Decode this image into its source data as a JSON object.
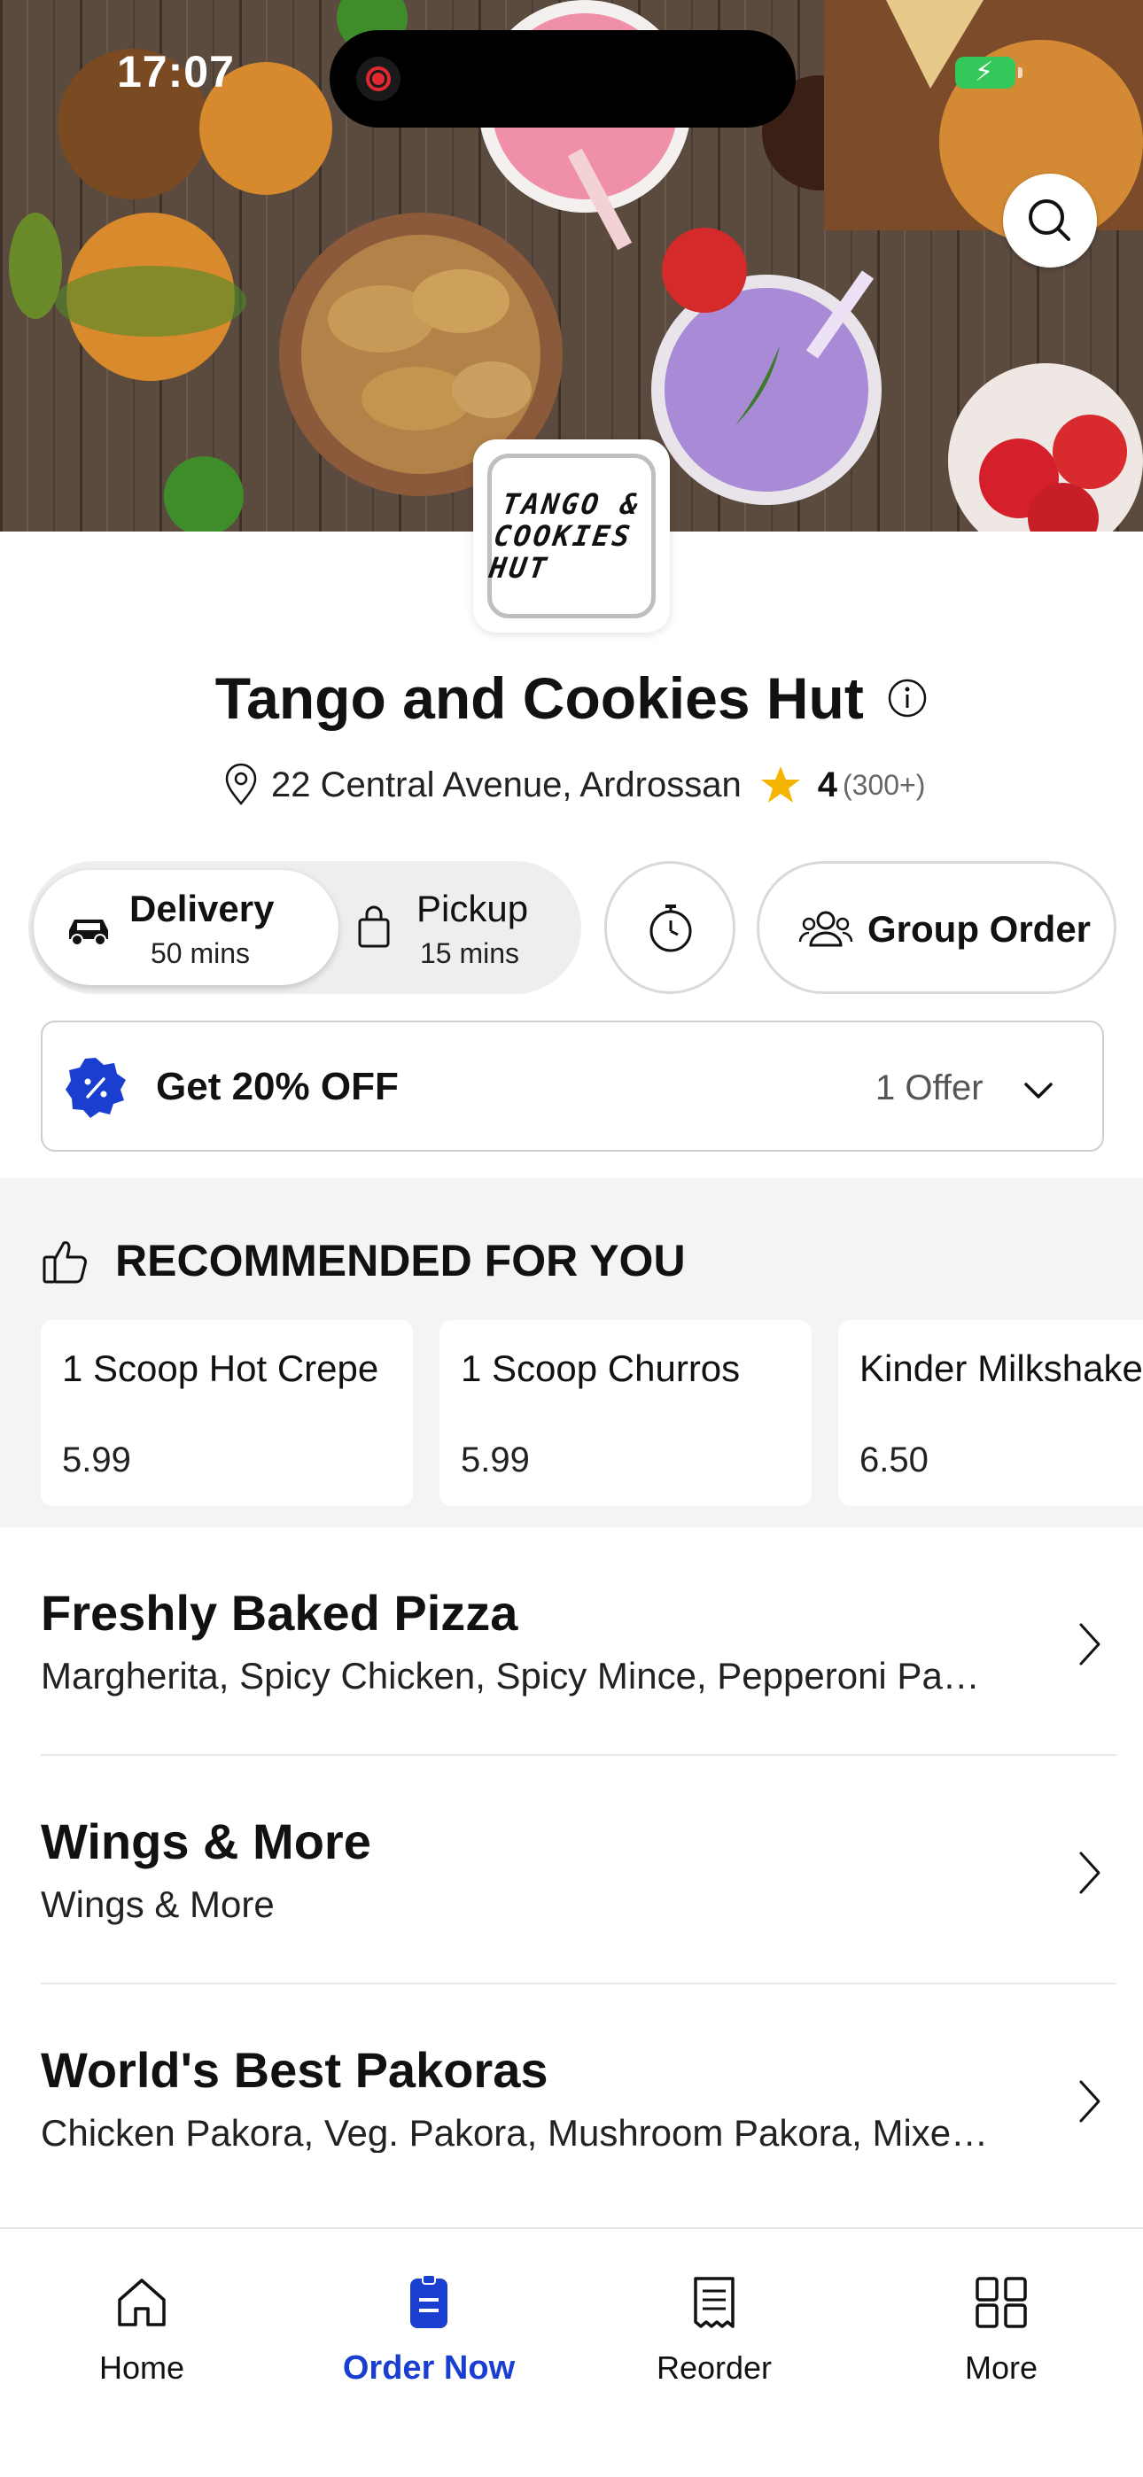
{
  "status_bar": {
    "time": "17:07"
  },
  "restaurant": {
    "logo_text_line1": "TANGO &",
    "logo_text_line2": "COOKIES HUT",
    "name": "Tango and Cookies Hut",
    "address": "22 Central Avenue, Ardrossan",
    "rating": "4",
    "rating_count": "(300+)"
  },
  "order_mode": {
    "delivery": {
      "label": "Delivery",
      "time": "50 mins",
      "selected": true
    },
    "pickup": {
      "label": "Pickup",
      "time": "15 mins",
      "selected": false
    },
    "group_order_label": "Group Order"
  },
  "offer": {
    "label": "Get 20% OFF",
    "count": "1 Offer"
  },
  "recommended": {
    "heading": "RECOMMENDED FOR YOU",
    "items": [
      {
        "name": "1 Scoop Hot Crepe",
        "price": "5.99"
      },
      {
        "name": "1 Scoop Churros",
        "price": "5.99"
      },
      {
        "name": "Kinder Milkshake",
        "price": "6.50"
      }
    ]
  },
  "categories": [
    {
      "title": "Freshly Baked Pizza",
      "subtitle": "Margherita, Spicy Chicken, Spicy Mince, Pepperoni Pa…"
    },
    {
      "title": "Wings & More",
      "subtitle": "Wings & More"
    },
    {
      "title": "World's Best Pakoras",
      "subtitle": "Chicken Pakora, Veg. Pakora, Mushroom Pakora, Mixe…"
    }
  ],
  "bottom_nav": [
    {
      "label": "Home",
      "icon": "home-icon",
      "active": false
    },
    {
      "label": "Order Now",
      "icon": "order-icon",
      "active": true
    },
    {
      "label": "Reorder",
      "icon": "receipt-icon",
      "active": false
    },
    {
      "label": "More",
      "icon": "grid-icon",
      "active": false
    }
  ],
  "colors": {
    "accent": "#1a3fd0",
    "star": "#f5b400",
    "battery": "#34c759"
  }
}
